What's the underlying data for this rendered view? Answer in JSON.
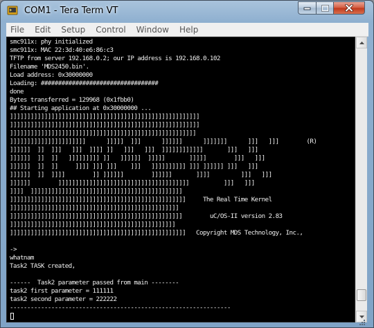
{
  "window": {
    "title": "COM1 - Tera Term VT",
    "app_icon": "tera-term-icon",
    "controls": [
      "minimize-icon",
      "maximize-icon",
      "close-icon"
    ],
    "close_color": "#c7452a"
  },
  "menubar": {
    "items": [
      "File",
      "Edit",
      "Setup",
      "Control",
      "Window",
      "Help"
    ]
  },
  "terminal": {
    "background": "#000000",
    "foreground": "#f2f2f2",
    "lines": [
      "smc911x: phy initialized",
      "smc911x: MAC 22:3d:40:e6:86:c3",
      "TFTP from server 192.168.0.2; our IP address is 192.168.0.102",
      "Filename 'MDS2450.bin'.",
      "Load address: 0x30000000",
      "Loading: ##################################",
      "done",
      "Bytes transferred = 129968 (0x1fbb0)",
      "## Starting application at 0x30000000 ...",
      "]]]]]]]]]]]]]]]]]]]]]]]]]]]]]]]]]]]]]]]]]]]]]]]]]]]]]]]",
      "]]]]]]]]]]]]]]]]]]]]]]]]]]]]]]]]]]]]]]]]]]]]]]]]]]]]]]]",
      "]]]]]]]]]]]]]]]]]]]]]]]]]]]]]]]]]]]]]]]]]]]]]]]]]]]]]]",
      "]]]]]]]]]]]]]]]]]]]]]]      ]]]]]  ]]]      ]]]]]]      ]]]]]]]      ]]]   ]]]        (R)",
      "]]]]]]  ]]  ]]]   ]]]  ]]]] ]]   ]]]   ]]]  ]]]]]]]]]]]]       ]]]   ]]]",
      "]]]]]]  ]]  ]]   ]]]]]]]]] ]]   ]]]]]]  ]]]]]       ]]]]]        ]]]   ]]]",
      "]]]]]]  ]]  ]]     ]]]] ]]] ]]]    ]]]   ]]]]]]]]]] ]]] ]]]]]] ]]]   ]]]",
      "]]]]]]  ]]  ]]]]        ]] ]]]]]]        ]]]]]]       ]]]]         ]]]   ]]]",
      "]]]]]]        ]]]]]]]]]]]]]]]]]]]]]]]]]]]]]]]]]]]]]]          ]]]   ]]]",
      "]]]]  ]]]]]]]]]]]]]]]]]]]]]]]]]]]]]]]]]]]]]]]]]]]]",
      "]]]]]]]]]]]]]]]]]]]]]]]]]]]]]]]]]]]]]]]]]]]]]]]]]]]     The Real Time Kernel",
      "]]]]]]]]]]]]]]]]]]]]]]]]]]]]]]]]]]]]]]]]]]]]]]]]]",
      "]]]]]]]]]]]]]]]]]]]]]]]]]]]]]]]]]]]]]]]]]]]]]]]]]]        uC/OS-II version 2.83",
      "]]]]]]]]]]]]]]]]]]]]]]]]]]]]]]]]]]]]]]]]]]]]]]]]",
      "]]]]]]]]]]]]]]]]]]]]]]]]]]]]]]]]]]]]]]]]]]]]]]]]]]]   Copyright MDS Technology, Inc.,",
      "",
      "->",
      "whatnam",
      "Task2 TASK created,",
      "",
      "------  Task2 parameter passed from main --------",
      "task2 first parameter = 111111",
      "task2 second parameter = 222222",
      "----------------------------------------------------------------"
    ]
  },
  "scrollbar": {
    "position": 0.96
  }
}
